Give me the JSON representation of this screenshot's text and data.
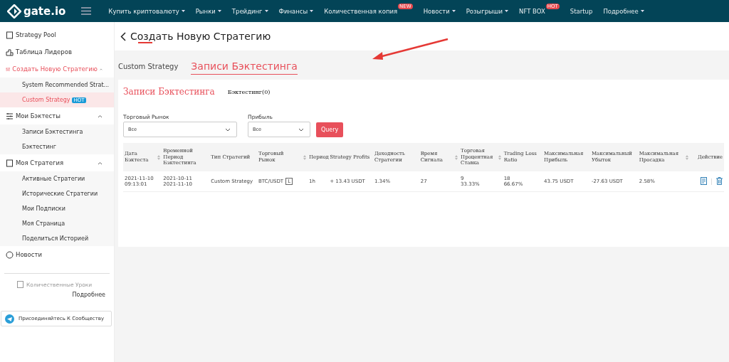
{
  "nav": {
    "brand": "gate.io",
    "items": [
      {
        "label": "Купить криптовалюту",
        "dropdown": true
      },
      {
        "label": "Рынки",
        "dropdown": true
      },
      {
        "label": "Трейдинг",
        "dropdown": true
      },
      {
        "label": "Финансы",
        "dropdown": true
      },
      {
        "label": "Количественная копия",
        "dropdown": false,
        "badge": "NEW"
      },
      {
        "label": "Новости",
        "dropdown": true
      },
      {
        "label": "Розыгрыши",
        "dropdown": true
      },
      {
        "label": "NFT BOX",
        "dropdown": false,
        "badge": "HOT"
      },
      {
        "label": "Startup",
        "dropdown": false
      },
      {
        "label": "Подробнее",
        "dropdown": true
      }
    ]
  },
  "sidebar": {
    "items": [
      {
        "label": "Strategy Pool",
        "selected": false
      },
      {
        "label": "Таблица Лидеров",
        "selected": false
      },
      {
        "label": "Создать Новую Стратегию",
        "selected": true,
        "expanded": true,
        "children": [
          {
            "label": "System Recommended Strat...",
            "selected": false
          },
          {
            "label": "Custom Strategy",
            "badge": "HOT",
            "selected": true
          }
        ]
      },
      {
        "label": "Мои Бэктесты",
        "selected": false,
        "expanded": true,
        "children": [
          {
            "label": "Записи Бэктестинга",
            "selected": false
          },
          {
            "label": "Бэктестинг",
            "selected": false
          }
        ]
      },
      {
        "label": "Моя Стратегия",
        "selected": false,
        "expanded": true,
        "children": [
          {
            "label": "Активные Стратегии",
            "selected": false
          },
          {
            "label": "Исторические Стратегии",
            "selected": false
          },
          {
            "label": "Мои Подписки",
            "selected": false
          },
          {
            "label": "Моя Страница",
            "selected": false
          },
          {
            "label": "Поделиться Историей",
            "selected": false
          }
        ]
      },
      {
        "label": "Новости",
        "selected": false
      }
    ],
    "lessons": "Количественные Уроки",
    "more": "Подробнее",
    "community_button": "Присоединяйтесь К Сообществу"
  },
  "page_title": "Создать Новую Стратегию",
  "tabs": [
    {
      "label": "Custom Strategy",
      "selected": false
    },
    {
      "label": "Записи Бэктестинга",
      "selected": true
    }
  ],
  "panel": {
    "title": "Записи Бэктестинга",
    "subtitle": "Бэктестинг(0)",
    "filters": [
      {
        "label": "Торговый Рынок",
        "value": "Все"
      },
      {
        "label": "Прибыль",
        "value": "Все"
      }
    ],
    "query_button": "Query",
    "table": {
      "columns": [
        {
          "label": "Дата Бэктеста",
          "sortable": true
        },
        {
          "label": "Временной Период Бэктестинга",
          "sortable": false
        },
        {
          "label": "Тип Стратегий",
          "sortable": false
        },
        {
          "label": "Торговый Рынок",
          "sortable": true
        },
        {
          "label": "Период",
          "sortable": false
        },
        {
          "label": "Strategy Profits",
          "sortable": false
        },
        {
          "label": "Доходность Стратегии",
          "sortable": false
        },
        {
          "label": "Время Сигнала",
          "sortable": true
        },
        {
          "label": "Торговая Процентная Ставка",
          "sortable": true
        },
        {
          "label": "Trading Loss Ratio",
          "sortable": false
        },
        {
          "label": "Максимальная Прибыль",
          "sortable": false
        },
        {
          "label": "Максимальный Убыток",
          "sortable": false
        },
        {
          "label": "Максимальная Просадка",
          "sortable": true
        },
        {
          "label": "Действие",
          "sortable": false
        }
      ],
      "rows": [
        {
          "cells": [
            {
              "lines": [
                "2021-11-10",
                "09:13:01"
              ]
            },
            {
              "lines": [
                "2021-10-11",
                "2021-11-10"
              ]
            },
            {
              "lines": [
                "Custom Strategy"
              ]
            },
            {
              "lines": [
                "BTC/USDT"
              ],
              "tag": "L"
            },
            {
              "lines": [
                "1h"
              ]
            },
            {
              "lines": [
                "+ 13.43 USDT"
              ]
            },
            {
              "lines": [
                "1.34%"
              ]
            },
            {
              "lines": [
                "27"
              ]
            },
            {
              "lines": [
                "9",
                "33.33%"
              ]
            },
            {
              "lines": [
                "18",
                "66.67%"
              ]
            },
            {
              "lines": [
                "43.75 USDT"
              ]
            },
            {
              "lines": [
                "-27.63 USDT"
              ]
            },
            {
              "lines": [
                "2.58%"
              ]
            },
            {
              "kind": "actions"
            }
          ]
        }
      ]
    }
  }
}
